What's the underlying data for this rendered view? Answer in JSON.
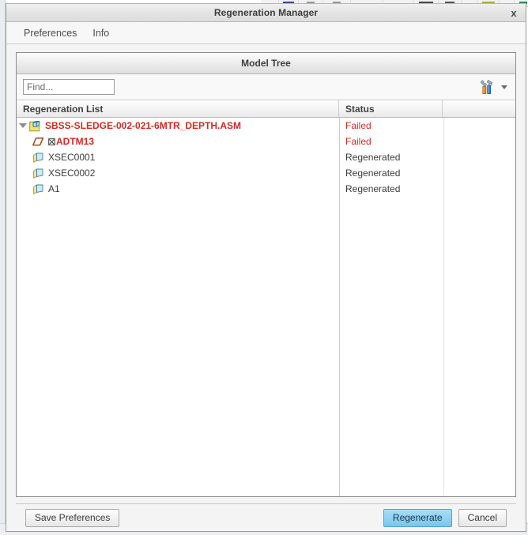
{
  "window": {
    "title": "Regeneration Manager",
    "close_label": "x",
    "close_icon": "close-icon"
  },
  "menubar": {
    "items": [
      {
        "label": "Preferences"
      },
      {
        "label": "Info"
      }
    ]
  },
  "panel": {
    "title": "Model Tree"
  },
  "find": {
    "value": "",
    "placeholder": "Find...",
    "tools_icon": "tools-icon",
    "dropdown_icon": "chevron-down-icon"
  },
  "table": {
    "columns": [
      {
        "label": "Regeneration List"
      },
      {
        "label": "Status"
      },
      {
        "label": ""
      }
    ],
    "rows": [
      {
        "label": "SBSS-SLEDGE-002-021-6MTR_DEPTH.ASM",
        "status": "Failed",
        "state": "failed",
        "depth": 0,
        "expanded": true,
        "icon": "assembly-icon",
        "suppressed": false
      },
      {
        "label": "ADTM13",
        "status": "Failed",
        "state": "failed",
        "depth": 1,
        "expanded": null,
        "icon": "datum-plane-icon",
        "suppressed": true
      },
      {
        "label": "XSEC0001",
        "status": "Regenerated",
        "state": "ok",
        "depth": 1,
        "expanded": null,
        "icon": "cross-section-icon",
        "suppressed": false
      },
      {
        "label": "XSEC0002",
        "status": "Regenerated",
        "state": "ok",
        "depth": 1,
        "expanded": null,
        "icon": "cross-section-icon",
        "suppressed": false
      },
      {
        "label": "A1",
        "status": "Regenerated",
        "state": "ok",
        "depth": 1,
        "expanded": null,
        "icon": "cross-section-icon",
        "suppressed": false
      }
    ]
  },
  "footer": {
    "save_preferences_label": "Save Preferences",
    "regenerate_label": "Regenerate",
    "cancel_label": "Cancel"
  },
  "colors": {
    "failed": "#d02b22",
    "normal": "#3b3b3b",
    "primary_button": "#8fd2f3",
    "dialog_background": "#f4f4f4"
  }
}
